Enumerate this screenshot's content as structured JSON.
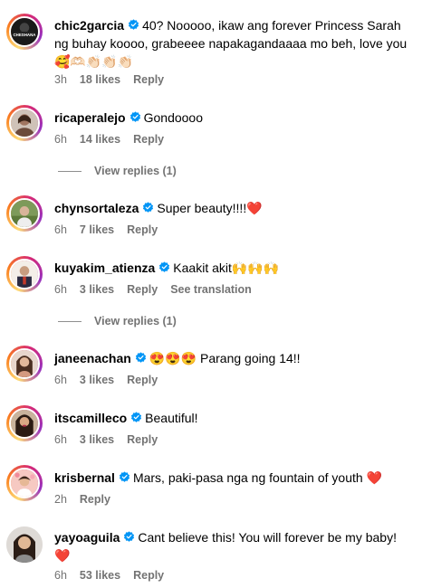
{
  "comments": [
    {
      "username": "chic2garcia",
      "text": "40? Nooooo, ikaw ang forever Princess Sarah ng buhay koooo, grabeeee napakagandaaaa mo beh, love you",
      "emojis": "🥰🫶🏻👏🏻👏🏻👏🏻",
      "time": "3h",
      "likes": "18 likes",
      "reply": "Reply",
      "avatar_text": "CHESHANA"
    },
    {
      "username": "ricaperalejo",
      "text": "Gondoooo",
      "time": "6h",
      "likes": "14 likes",
      "reply": "Reply",
      "view_replies": "View replies (1)"
    },
    {
      "username": "chynsortaleza",
      "text": "Super beauty!!!!",
      "emojis": "❤️",
      "time": "6h",
      "likes": "7 likes",
      "reply": "Reply"
    },
    {
      "username": "kuyakim_atienza",
      "text": "Kaakit akit",
      "emojis": "🙌🙌🙌",
      "time": "6h",
      "likes": "3 likes",
      "reply": "Reply",
      "translate": "See translation",
      "view_replies": "View replies (1)"
    },
    {
      "username": "janeenachan",
      "emojis": "😍😍😍",
      "text": "Parang going 14!!",
      "time": "6h",
      "likes": "3 likes",
      "reply": "Reply"
    },
    {
      "username": "itscamilleco",
      "text": "Beautiful!",
      "time": "6h",
      "likes": "3 likes",
      "reply": "Reply"
    },
    {
      "username": "krisbernal",
      "text": "Mars, paki-pasa nga ng fountain of youth",
      "emojis": "❤️",
      "time": "2h",
      "reply": "Reply"
    },
    {
      "username": "yayoaguila",
      "text": "Cant believe this! You will forever be my baby!",
      "emojis": "❤️",
      "time": "6h",
      "likes": "53 likes",
      "reply": "Reply"
    }
  ],
  "colors": {
    "verified": "#0095f6",
    "meta": "#737373",
    "heart": "#e0245e"
  },
  "icons": {
    "verified": "verified-badge-icon"
  }
}
